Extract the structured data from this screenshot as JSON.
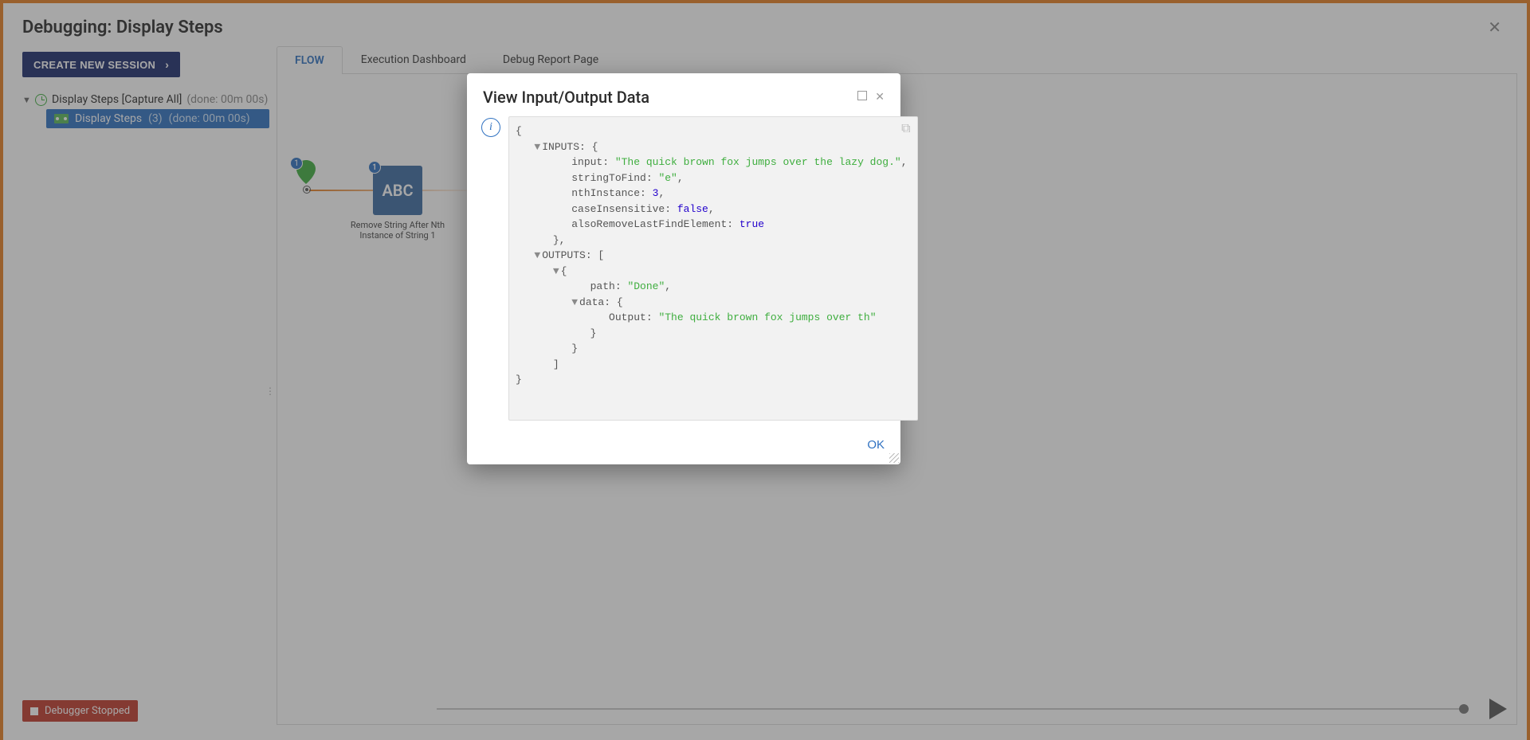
{
  "header": {
    "title": "Debugging: Display Steps"
  },
  "sidebar": {
    "create_label": "CREATE NEW SESSION",
    "tree": {
      "root_label": "Display Steps [Capture All]",
      "root_status": "(done: 00m 00s)",
      "child_label": "Display Steps",
      "child_count": "(3)",
      "child_status": "(done: 00m 00s)"
    },
    "footer_badge": "Debugger Stopped"
  },
  "content": {
    "tabs": [
      {
        "label": "FLOW",
        "active": true
      },
      {
        "label": "Execution Dashboard",
        "active": false
      },
      {
        "label": "Debug Report Page",
        "active": false
      }
    ],
    "flow": {
      "badge1": "1",
      "badge2": "1",
      "abc_text": "ABC",
      "abc_caption_line1": "Remove String After Nth",
      "abc_caption_line2": "Instance of String 1"
    }
  },
  "modal": {
    "title": "View Input/Output Data",
    "ok_label": "OK",
    "code": {
      "open": "{",
      "inputs_open": "INPUTS: {",
      "input_key": "input: ",
      "input_val": "\"The quick brown fox jumps over the lazy dog.\"",
      "stf_key": "stringToFind: ",
      "stf_val": "\"e\"",
      "nth_key": "nthInstance: ",
      "nth_val": "3",
      "ci_key": "caseInsensitive: ",
      "ci_val": "false",
      "arlfe_key": "alsoRemoveLastFindElement: ",
      "arlfe_val": "true",
      "inputs_close": "},",
      "outputs_open": "OUTPUTS: [",
      "obj_open": "{",
      "path_key": "path: ",
      "path_val": "\"Done\"",
      "data_open": "data: {",
      "output_key": "Output: ",
      "output_val": "\"The quick brown fox jumps over th\"",
      "data_close": "}",
      "obj_close": "}",
      "outputs_close": "]",
      "close": "}"
    }
  }
}
